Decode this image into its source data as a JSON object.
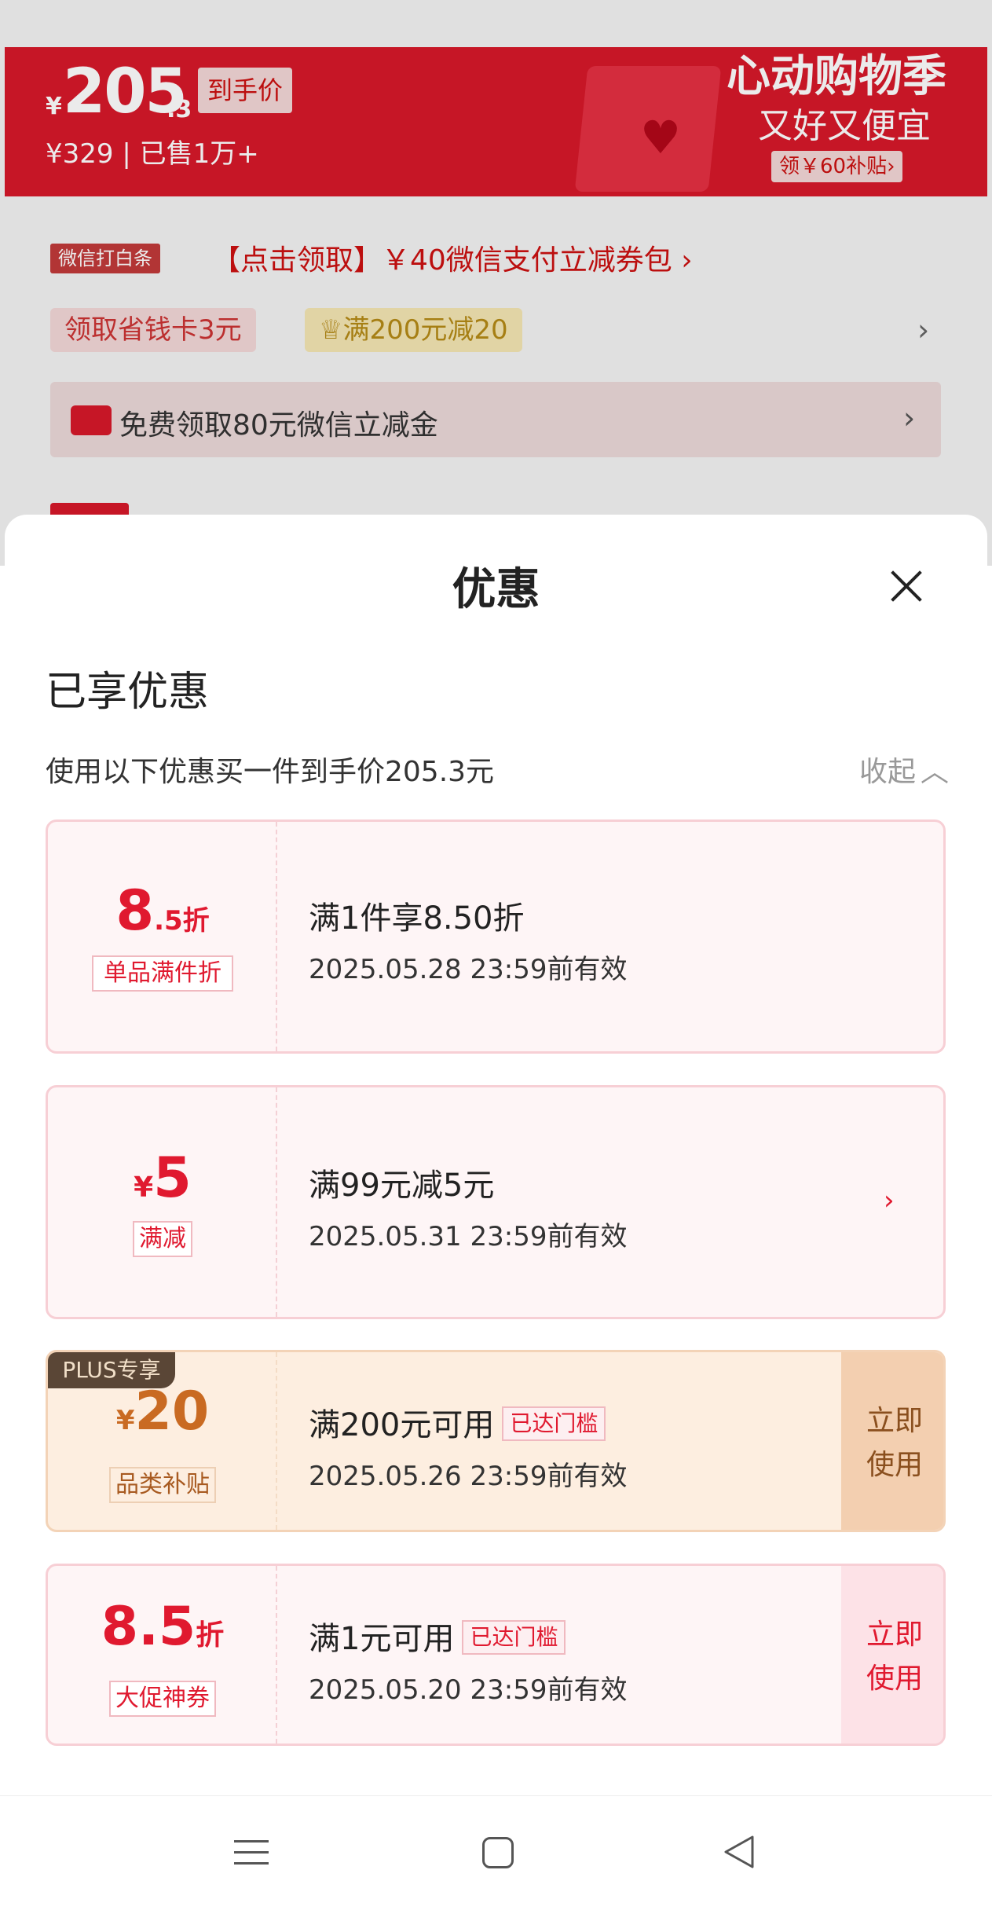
{
  "background_page": {
    "promo": {
      "price_symbol": "¥",
      "price_integer": "205",
      "price_decimal": ".3",
      "price_tag": "到手价",
      "original_price": "¥329 | 已售1万+",
      "season_title": "心动购物季",
      "season_subtitle": "又好又便宜",
      "season_coupon": "领￥60补贴›"
    },
    "wechat_tag": "微信打白条",
    "wechat_link": "【点击领取】￥40微信支付立减券包 ›",
    "chip_save": "领取省钱卡3元",
    "chip_full": "♕满200元减20",
    "free_row": "免费领取80元微信立减金"
  },
  "sheet": {
    "title": "优惠",
    "section_title": "已享优惠",
    "summary": "使用以下优惠买一件到手价205.3元",
    "collapse_label": "收起"
  },
  "coupons": [
    {
      "big_main": "8",
      "big_small": ".5折",
      "tag": "单品满件折",
      "condition": "满1件享8.50折",
      "validity": "2025.05.28 23:59前有效"
    },
    {
      "big_prefix": "¥",
      "big_main": "5",
      "tag": "满减",
      "condition": "满99元减5元",
      "validity": "2025.05.31 23:59前有效",
      "chevron": "›"
    },
    {
      "badge": "PLUS专享",
      "big_prefix": "¥",
      "big_main": "20",
      "tag": "品类补贴",
      "condition": "满200元可用",
      "reached": "已达门槛",
      "validity": "2025.05.26 23:59前有效",
      "action_line1": "立即",
      "action_line2": "使用"
    },
    {
      "big_main": "8.5",
      "big_small": "折",
      "tag": "大促神券",
      "condition": "满1元可用",
      "reached": "已达门槛",
      "validity": "2025.05.20 23:59前有效",
      "action_line1": "立即",
      "action_line2": "使用"
    }
  ],
  "colors": {
    "brand_red": "#e0192f",
    "promo_red": "#d7182a",
    "plus_card": "#fdeee0"
  }
}
